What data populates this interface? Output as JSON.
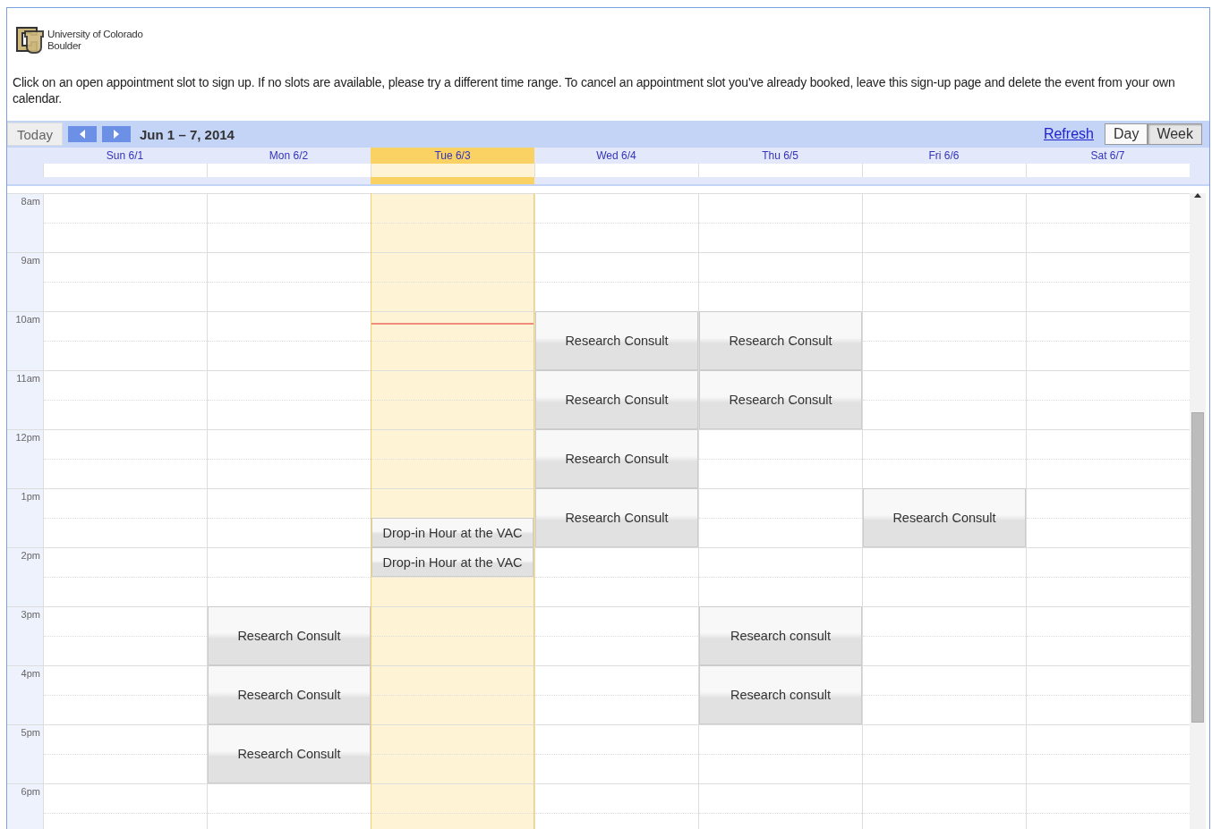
{
  "header": {
    "logo_text": [
      "University of Colorado",
      "Boulder"
    ]
  },
  "instructions": "Click on an open appointment slot to sign up. If no slots are available, please try a different time range. To cancel an appointment slot you've already booked, leave this sign-up page and delete the event from your own calendar.",
  "toolbar": {
    "today": "Today",
    "range": "Jun 1 – 7, 2014",
    "refresh": "Refresh",
    "views": [
      {
        "label": "Day",
        "selected": false
      },
      {
        "label": "Week",
        "selected": true
      }
    ]
  },
  "hours": [
    "8am",
    "9am",
    "10am",
    "11am",
    "12pm",
    "1pm",
    "2pm",
    "3pm",
    "4pm",
    "5pm",
    "6pm"
  ],
  "days": [
    {
      "label": "Sun 6/1",
      "today": false
    },
    {
      "label": "Mon 6/2",
      "today": false,
      "events": [
        "Research Consult",
        "Research Consult",
        "Research Consult"
      ]
    },
    {
      "label": "Tue 6/3",
      "today": true,
      "events": [
        "Drop-in Hour at the VAC",
        "Drop-in Hour at the VAC"
      ]
    },
    {
      "label": "Wed 6/4",
      "today": false,
      "events": [
        "Research Consult",
        "Research Consult",
        "Research Consult",
        "Research Consult"
      ]
    },
    {
      "label": "Thu 6/5",
      "today": false,
      "events": [
        "Research Consult",
        "Research Consult",
        "Research consult",
        "Research consult"
      ]
    },
    {
      "label": "Fri 6/6",
      "today": false,
      "events": [
        "Research Consult"
      ]
    },
    {
      "label": "Sat 6/7",
      "today": false
    }
  ]
}
